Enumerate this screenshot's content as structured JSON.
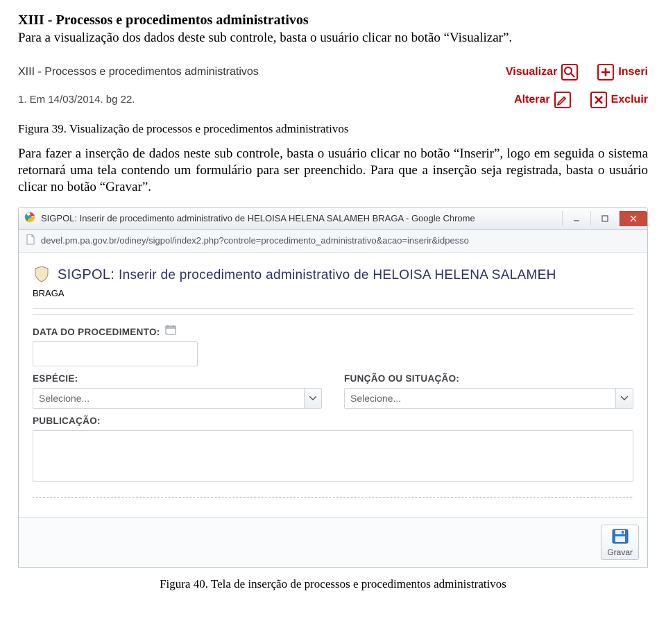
{
  "heading": "XIII - Processos e procedimentos administrativos",
  "intro": "Para a visualização dos dados deste sub controle, basta o usuário clicar no botão “Visualizar”.",
  "shot1": {
    "title": "XIII - Processos e procedimentos administrativos",
    "item": "1. Em 14/03/2014. bg 22.",
    "actions": {
      "visualizar": "Visualizar",
      "inseri": "Inseri",
      "alterar": "Alterar",
      "excluir": "Excluir"
    }
  },
  "caption1": "Figura 39. Visualização de processos e procedimentos administrativos",
  "body_after": "Para fazer a inserção de dados neste sub controle, basta o usuário clicar no botão “Inserir”, logo em seguida o sistema retornará uma tela contendo um formulário para ser preenchido. Para que a inserção seja registrada, basta o usuário clicar no botão “Gravar”.",
  "chrome": {
    "title": "SIGPOL: Inserir de procedimento administrativo de HELOISA HELENA SALAMEH BRAGA - Google Chrome",
    "url": "devel.pm.pa.gov.br/odiney/sigpol/index2.php?controle=procedimento_administrativo&acao=inserir&idpesso",
    "brand_prefix": "SIGPOL:",
    "brand_rest": "Inserir de procedimento administrativo de HELOISA HELENA SALAMEH",
    "brand_line2": "BRAGA",
    "labels": {
      "data": "DATA DO PROCEDIMENTO:",
      "especie": "ESPÉCIE:",
      "funcao": "FUNÇÃO OU SITUAÇÃO:",
      "publicacao": "PUBLICAÇÃO:"
    },
    "select_placeholder": "Selecione...",
    "gravar": "Gravar"
  },
  "caption2": "Figura 40. Tela de inserção de processos e procedimentos administrativos"
}
